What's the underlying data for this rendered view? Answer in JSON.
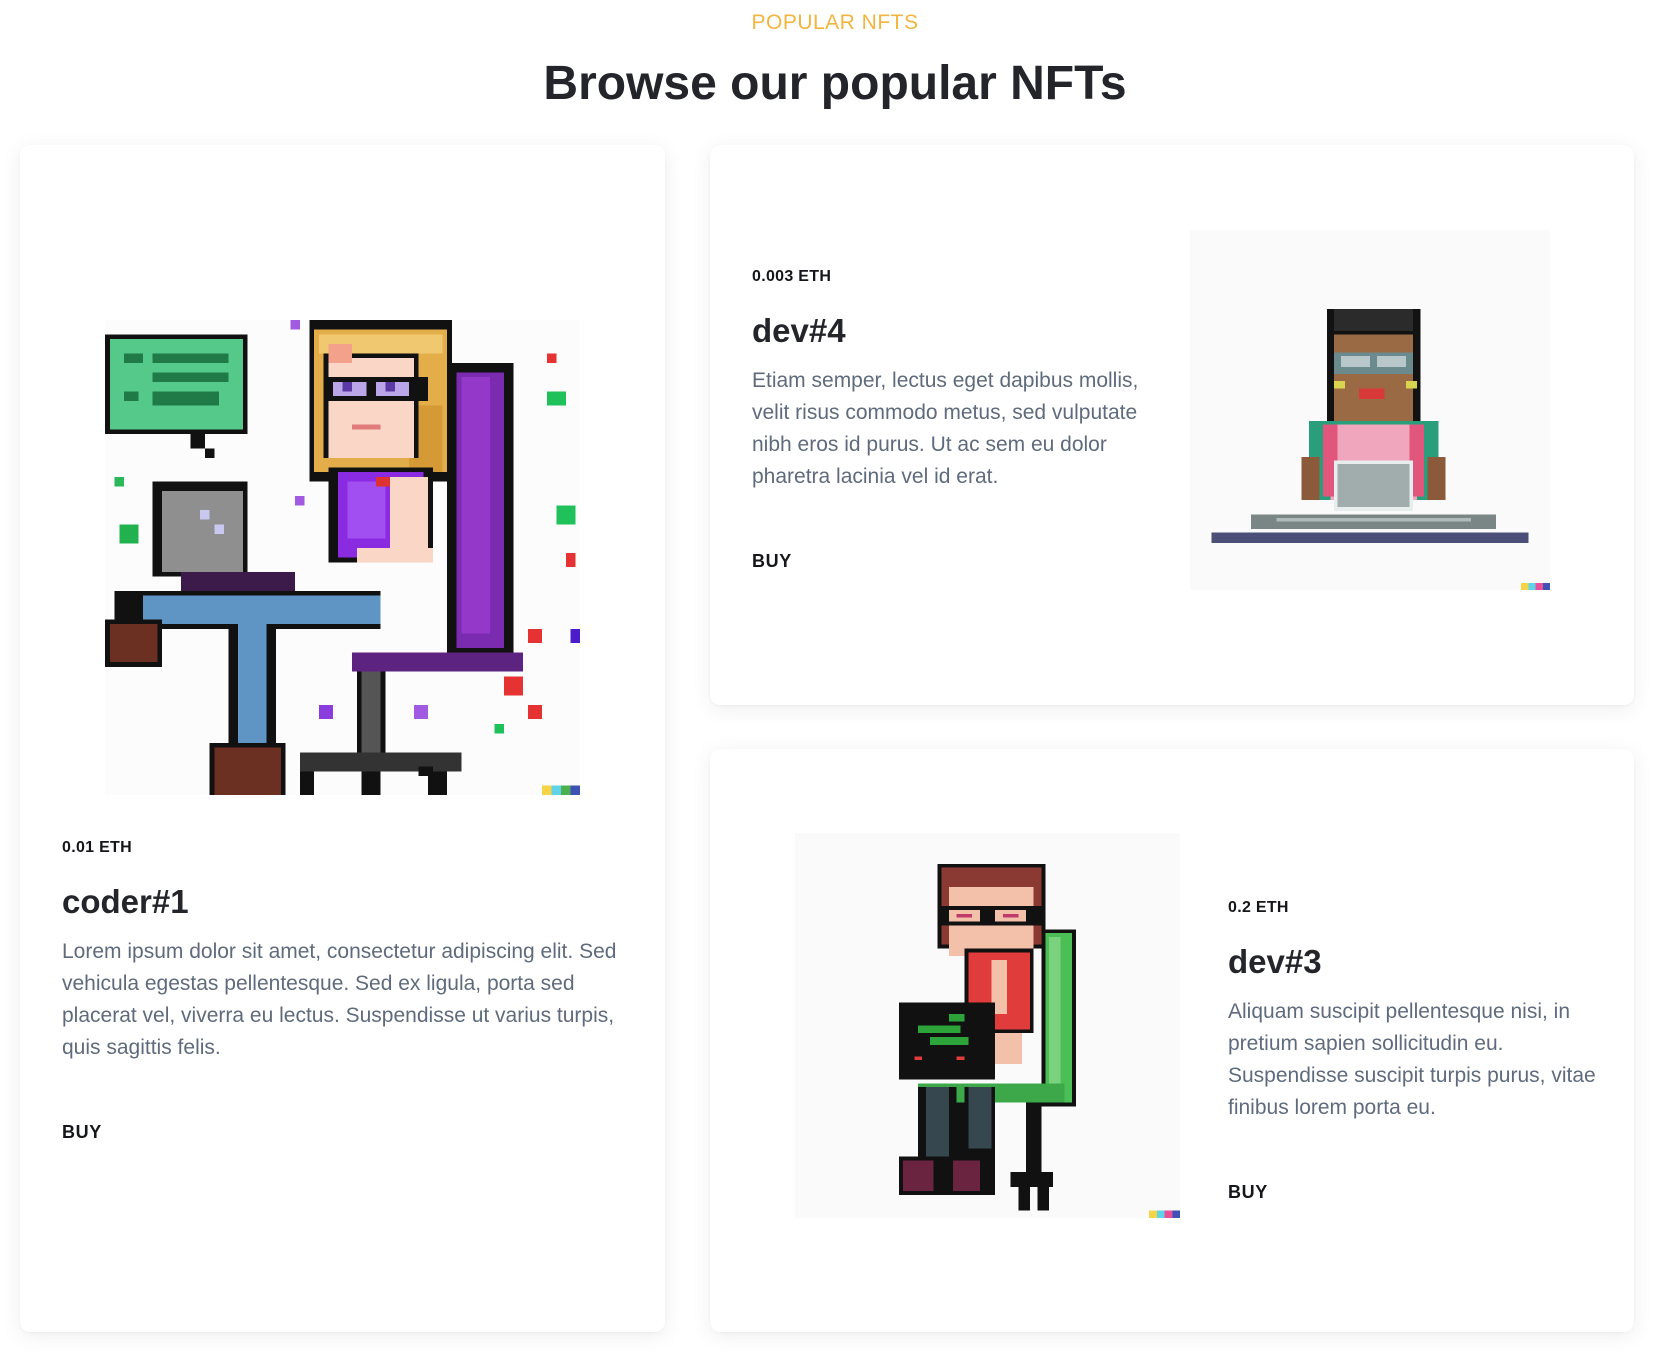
{
  "section": {
    "eyebrow": "POPULAR NFTS",
    "title": "Browse our popular NFTs"
  },
  "nfts": [
    {
      "price": "0.01 ETH",
      "name": "coder#1",
      "description": "Lorem ipsum dolor sit amet, consectetur adipiscing elit. Sed vehicula egestas pellentesque. Sed ex ligula, porta sed placerat vel, viverra eu lectus. Suspendisse ut varius turpis, quis sagittis felis.",
      "buy_label": "BUY"
    },
    {
      "price": "0.003 ETH",
      "name": "dev#4",
      "description": "Etiam semper, lectus eget dapibus mollis, velit risus commodo metus, sed vulputate nibh eros id purus. Ut ac sem eu dolor pharetra lacinia vel id erat.",
      "buy_label": "BUY"
    },
    {
      "price": "0.2 ETH",
      "name": "dev#3",
      "description": "Aliquam suscipit pellentesque nisi, in pretium sapien sollicitudin eu. Suspendisse suscipit turpis purus, vitae finibus lorem porta eu.",
      "buy_label": "BUY"
    }
  ],
  "colors": {
    "accent": "#f2b540",
    "heading": "#23252b",
    "body_text": "#5f6b7c"
  }
}
